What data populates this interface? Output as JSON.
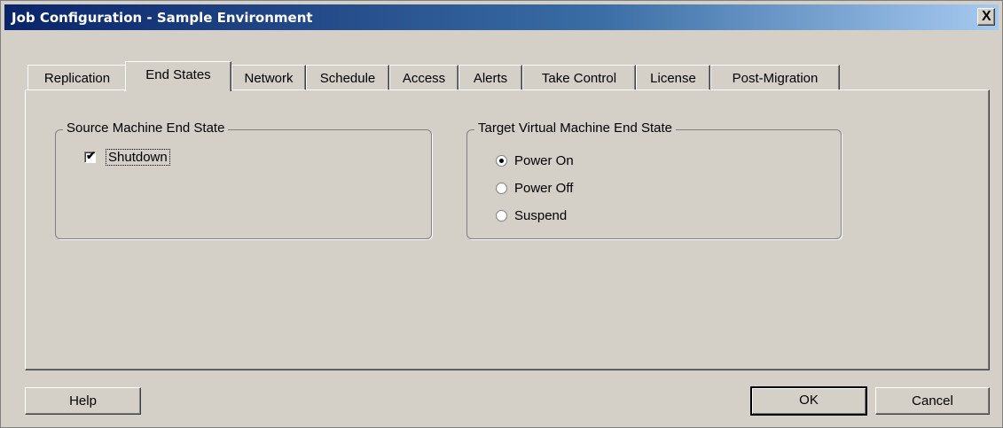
{
  "window": {
    "title": "Job Configuration - Sample Environment",
    "close_glyph": "X"
  },
  "tabs": [
    {
      "label": "Replication"
    },
    {
      "label": "End States"
    },
    {
      "label": "Network"
    },
    {
      "label": "Schedule"
    },
    {
      "label": "Access"
    },
    {
      "label": "Alerts"
    },
    {
      "label": "Take Control"
    },
    {
      "label": "License"
    },
    {
      "label": "Post-Migration"
    }
  ],
  "active_tab": "End States",
  "source_group": {
    "legend": "Source Machine End State",
    "checkbox": {
      "label": "Shutdown",
      "checked": true,
      "mark": "✔"
    }
  },
  "target_group": {
    "legend": "Target Virtual Machine End State",
    "options": [
      {
        "label": "Power On",
        "selected": true
      },
      {
        "label": "Power Off",
        "selected": false
      },
      {
        "label": "Suspend",
        "selected": false
      }
    ]
  },
  "buttons": {
    "help": "Help",
    "ok": "OK",
    "cancel": "Cancel"
  }
}
